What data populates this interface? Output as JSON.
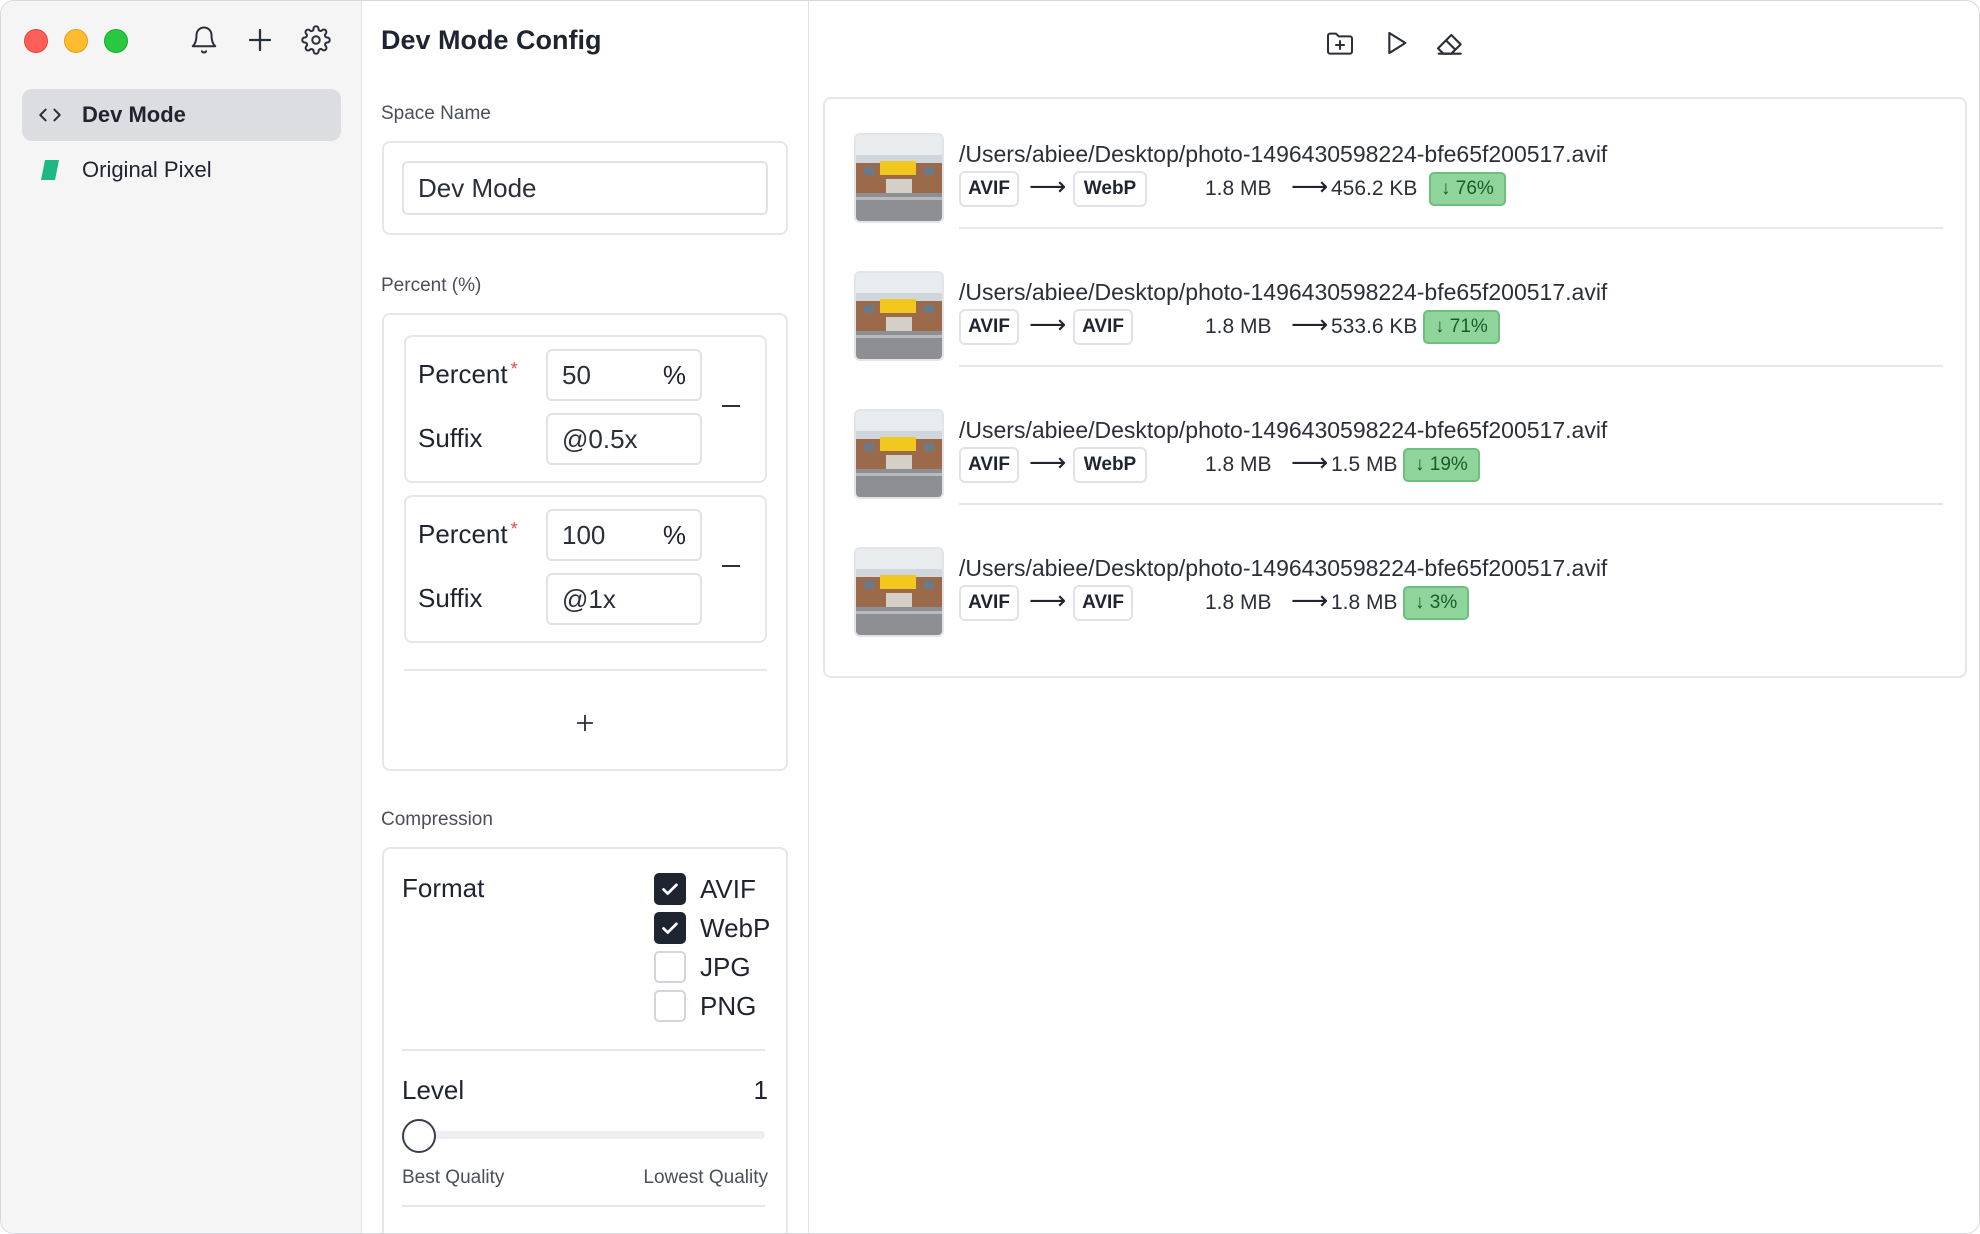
{
  "sidebar": {
    "items": [
      {
        "label": "Dev Mode",
        "icon": "code-icon",
        "active": true
      },
      {
        "label": "Original Pixel",
        "icon": "pixel-logo-icon",
        "active": false
      }
    ]
  },
  "config": {
    "title": "Dev Mode Config",
    "space_name": {
      "label": "Space Name",
      "value": "Dev Mode"
    },
    "percent": {
      "label": "Percent (%)",
      "percent_label": "Percent",
      "required_mark": "*",
      "suffix_label": "Suffix",
      "unit": "%",
      "entries": [
        {
          "percent": "50",
          "suffix": "@0.5x"
        },
        {
          "percent": "100",
          "suffix": "@1x"
        }
      ]
    },
    "compression": {
      "label": "Compression",
      "format_label": "Format",
      "formats": [
        {
          "name": "AVIF",
          "checked": true
        },
        {
          "name": "WebP",
          "checked": true
        },
        {
          "name": "JPG",
          "checked": false
        },
        {
          "name": "PNG",
          "checked": false
        }
      ],
      "level_label": "Level",
      "level_value": "1",
      "level_min_label": "Best Quality",
      "level_max_label": "Lowest Quality",
      "level_fraction": 0.0
    }
  },
  "results": [
    {
      "path": "/Users/abiee/Desktop/photo-1496430598224-bfe65f200517.avif",
      "from_format": "AVIF",
      "to_format": "WebP",
      "from_size": "1.8 MB",
      "to_size": "456.2 KB",
      "reduction": "↓ 76%"
    },
    {
      "path": "/Users/abiee/Desktop/photo-1496430598224-bfe65f200517.avif",
      "from_format": "AVIF",
      "to_format": "AVIF",
      "from_size": "1.8 MB",
      "to_size": "533.6 KB",
      "reduction": "↓ 71%"
    },
    {
      "path": "/Users/abiee/Desktop/photo-1496430598224-bfe65f200517.avif",
      "from_format": "AVIF",
      "to_format": "WebP",
      "from_size": "1.8 MB",
      "to_size": "1.5 MB",
      "reduction": "↓ 19%"
    },
    {
      "path": "/Users/abiee/Desktop/photo-1496430598224-bfe65f200517.avif",
      "from_format": "AVIF",
      "to_format": "AVIF",
      "from_size": "1.8 MB",
      "to_size": "1.8 MB",
      "reduction": "↓ 3%"
    }
  ],
  "arrow_glyph": "⟶",
  "colors": {
    "badge_green": "#8fd49b",
    "checkbox_checked": "#1e2430",
    "pixel_logo": "#1fb784"
  }
}
